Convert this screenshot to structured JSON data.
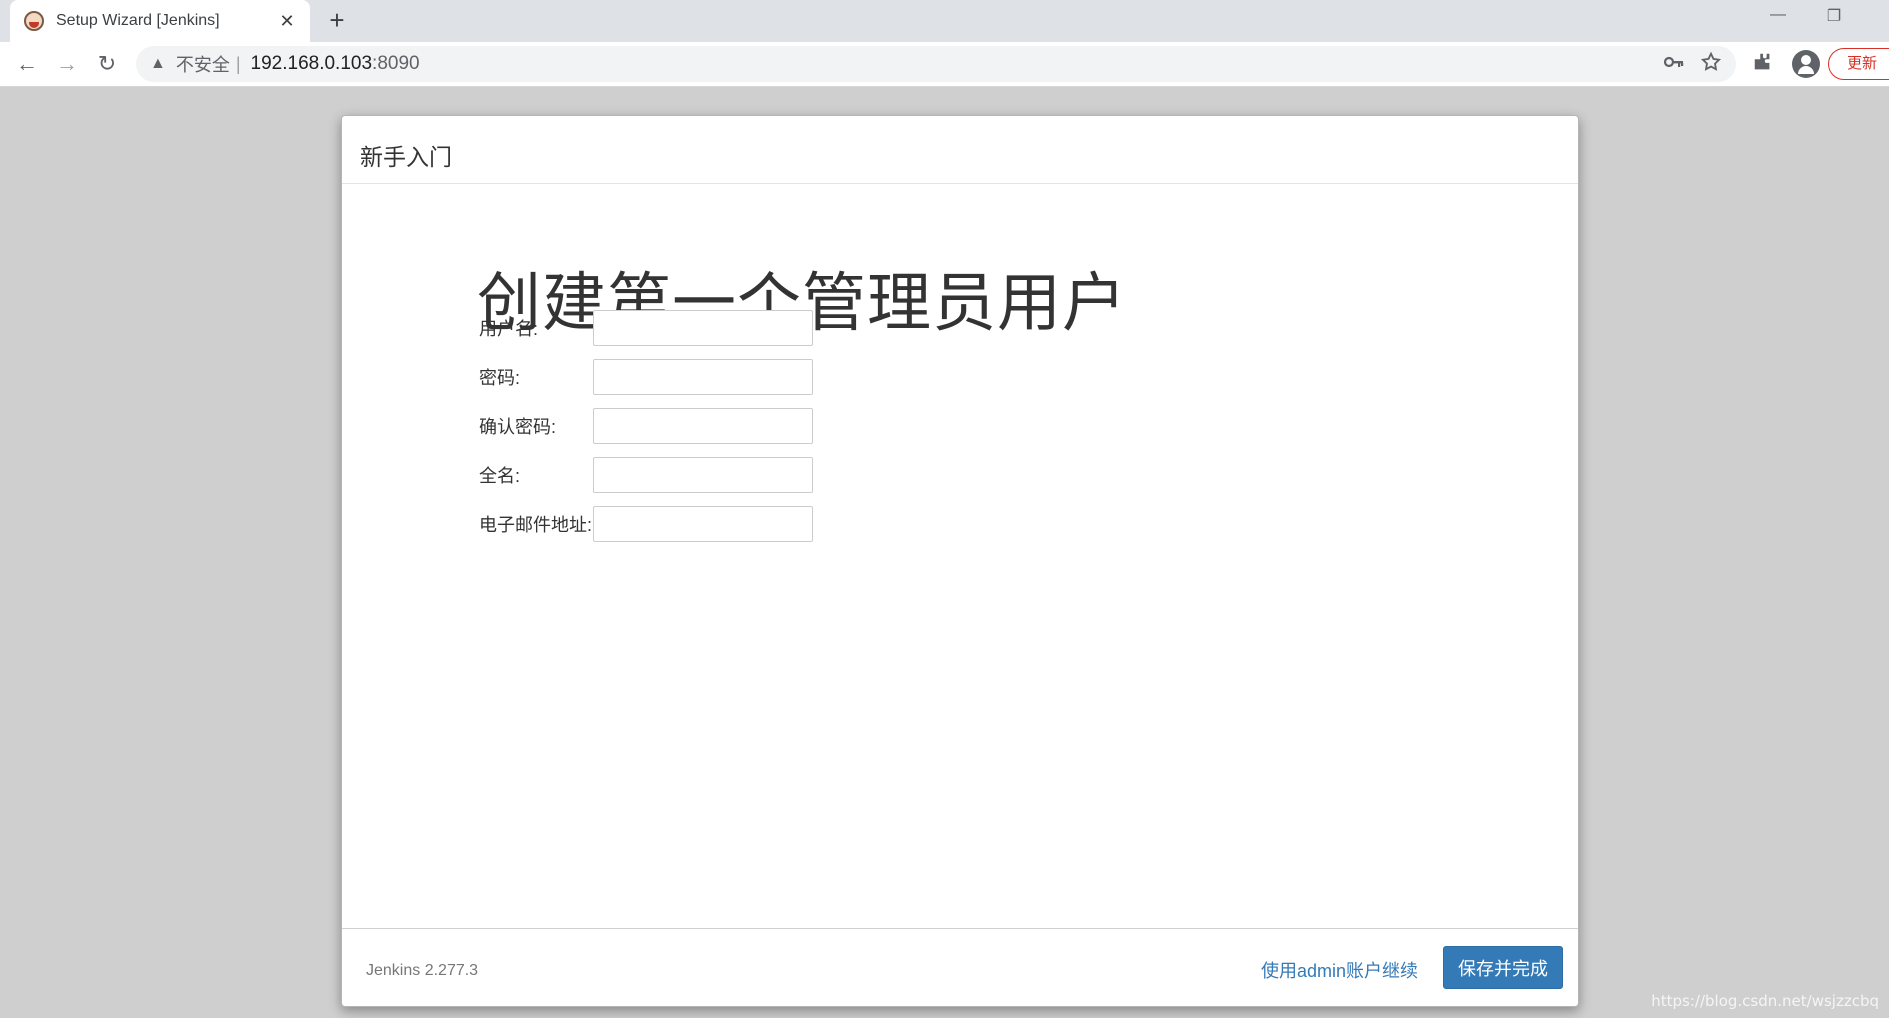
{
  "browser": {
    "tab_title": "Setup Wizard [Jenkins]",
    "tab_close_glyph": "✕",
    "new_tab_glyph": "+",
    "window_controls": {
      "minimize": "—",
      "restore": "❐"
    },
    "nav": {
      "back": "←",
      "forward": "→",
      "reload": "↻"
    },
    "address": {
      "warning_glyph": "▲",
      "security_label": "不安全",
      "separator": "|",
      "host": "192.168.0.103",
      "port": ":8090"
    },
    "update_label": "更新"
  },
  "dialog": {
    "header_title": "新手入门",
    "main_title": "创建第一个管理员用户",
    "fields": [
      {
        "label": "用户名:",
        "value": ""
      },
      {
        "label": "密码:",
        "value": ""
      },
      {
        "label": "确认密码:",
        "value": ""
      },
      {
        "label": "全名:",
        "value": ""
      },
      {
        "label": "电子邮件地址:",
        "value": ""
      }
    ],
    "footer": {
      "version": "Jenkins 2.277.3",
      "continue_as_admin": "使用admin账户继续",
      "save_and_finish": "保存并完成"
    }
  },
  "watermark": "https://blog.csdn.net/wsjzzcbq",
  "colors": {
    "primary": "#337ab7",
    "update_red": "#d93025",
    "page_bg": "#cfcfcf"
  },
  "icons": [
    "jenkins-favicon",
    "warning-icon",
    "key-icon",
    "star-icon",
    "extensions-icon",
    "profile-icon"
  ]
}
